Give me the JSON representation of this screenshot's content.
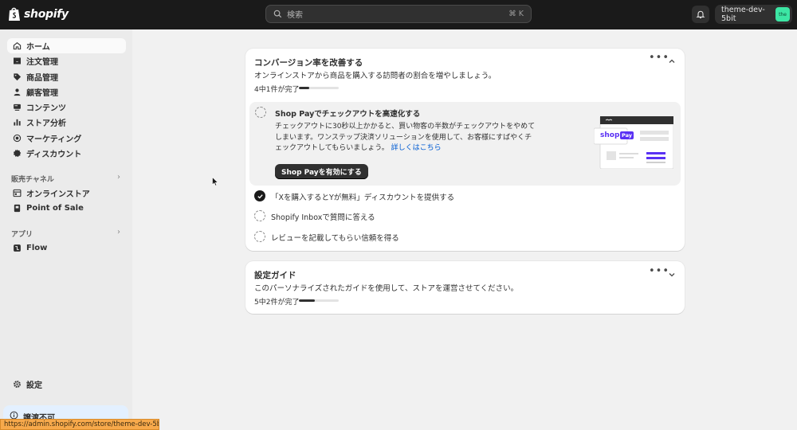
{
  "topbar": {
    "logo_text": "shopify",
    "search_placeholder": "検索",
    "search_shortcut": "⌘ K",
    "store_name": "theme-dev-5bit",
    "avatar_text": "the"
  },
  "sidebar": {
    "items": [
      {
        "label": "ホーム",
        "icon": "home-icon"
      },
      {
        "label": "注文管理",
        "icon": "inbox-icon"
      },
      {
        "label": "商品管理",
        "icon": "tag-icon"
      },
      {
        "label": "顧客管理",
        "icon": "person-icon"
      },
      {
        "label": "コンテンツ",
        "icon": "content-icon"
      },
      {
        "label": "ストア分析",
        "icon": "bar-chart-icon"
      },
      {
        "label": "マーケティング",
        "icon": "target-icon"
      },
      {
        "label": "ディスカウント",
        "icon": "discount-icon"
      }
    ],
    "sales_channels_label": "販売チャネル",
    "channels": [
      {
        "label": "オンラインストア",
        "icon": "storefront-icon"
      },
      {
        "label": "Point of Sale",
        "icon": "pos-icon"
      }
    ],
    "apps_label": "アプリ",
    "apps": [
      {
        "label": "Flow",
        "icon": "flow-icon"
      }
    ],
    "settings_label": "設定",
    "notice_label": "譲渡不可"
  },
  "status_url": "https://admin.shopify.com/store/theme-dev-5bit",
  "conversion_card": {
    "title": "コンバージョン率を改善する",
    "subtitle": "オンラインストアから商品を購入する訪問者の割合を増やしましょう。",
    "progress_text": "4中1件が完了",
    "progress_fraction": 0.25,
    "expanded_task": {
      "title": "Shop Payでチェックアウトを高速化する",
      "description": "チェックアウトに30秒以上かかると、買い物客の半数がチェックアウトをやめてしまいます。ワンステップ決済ソリューションを使用して、お客様にすばやくチェックアウトしてもらいましょう。",
      "link_text": "詳しくはこちら",
      "button_label": "Shop Payを有効にする",
      "illustration_label": "shop",
      "illustration_badge": "Pay"
    },
    "tasks": [
      {
        "label": "「Xを購入するとYが無料」ディスカウントを提供する",
        "done": true
      },
      {
        "label": "Shopify Inboxで質問に答える",
        "done": false
      },
      {
        "label": "レビューを記載してもらい信頼を得る",
        "done": false
      }
    ]
  },
  "setup_card": {
    "title": "設定ガイド",
    "subtitle": "このパーソナライズされたガイドを使用して、ストアを運営させてください。",
    "progress_text": "5中2件が完了",
    "progress_fraction": 0.4
  },
  "colors": {
    "topbar_bg": "#1a1a1a",
    "sidebar_bg": "#ebebeb",
    "main_bg": "#f1f1f1",
    "link": "#005bd3",
    "avatar": "#3ce6a4",
    "shop_pay": "#5a31f4"
  }
}
